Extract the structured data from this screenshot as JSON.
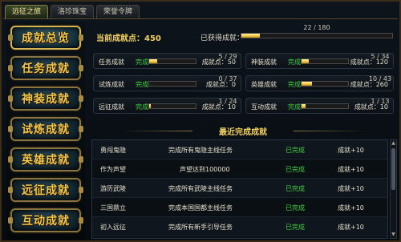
{
  "tabs": [
    {
      "label": "远征之旅",
      "active": true
    },
    {
      "label": "洛珍珠宝",
      "active": false
    },
    {
      "label": "荣誉令牌",
      "active": false
    }
  ],
  "sidebar": {
    "items": [
      {
        "label": "成就总览",
        "active": true
      },
      {
        "label": "任务成就",
        "active": false
      },
      {
        "label": "神装成就",
        "active": false
      },
      {
        "label": "试炼成就",
        "active": false
      },
      {
        "label": "英雄成就",
        "active": false
      },
      {
        "label": "远征成就",
        "active": false
      },
      {
        "label": "互动成就",
        "active": false
      }
    ]
  },
  "summary": {
    "current_label": "当前成就点：450",
    "obtained_label": "已获得成就：",
    "obtained_count": "22 / 180",
    "obtained_progress": 0.122
  },
  "categories": [
    {
      "name": "任务成就",
      "status": "完成",
      "count": "5 / 29",
      "progress": 0.17,
      "points": "成就点：50"
    },
    {
      "name": "神装成就",
      "status": "完成",
      "count": "5 / 34",
      "progress": 0.15,
      "points": "成就点：120"
    },
    {
      "name": "试炼成就",
      "status": "完成",
      "count": "0 / 37",
      "progress": 0.0,
      "points": "成就点：0"
    },
    {
      "name": "英雄成就",
      "status": "完成",
      "count": "10 / 43",
      "progress": 0.23,
      "points": "成就点：260"
    },
    {
      "name": "远征成就",
      "status": "完成",
      "count": "1 / 24",
      "progress": 0.04,
      "points": "成就点：10"
    },
    {
      "name": "互动成就",
      "status": "完成",
      "count": "1 / 13",
      "progress": 0.08,
      "points": "成就点：10"
    }
  ],
  "recent": {
    "title": "最近完成成就",
    "rows": [
      {
        "name": "勇闯鬼隐",
        "desc": "完成所有鬼隐主线任务",
        "status": "已完成",
        "points": "成就+10"
      },
      {
        "name": "作为声望",
        "desc": "声望达到100000",
        "status": "已完成",
        "points": "成就+10"
      },
      {
        "name": "游历武陵",
        "desc": "完成所有武陵主线任务",
        "status": "已完成",
        "points": "成就+10"
      },
      {
        "name": "三国鼎立",
        "desc": "完成本国国都主线任务",
        "status": "已完成",
        "points": "成就+10"
      },
      {
        "name": "初入远征",
        "desc": "完成所有新手引导任务",
        "status": "已完成",
        "points": "成就+10"
      }
    ]
  },
  "colors": {
    "accent": "#f0d060",
    "complete": "#3fd23f",
    "bar_fill": "#f2c63a"
  }
}
